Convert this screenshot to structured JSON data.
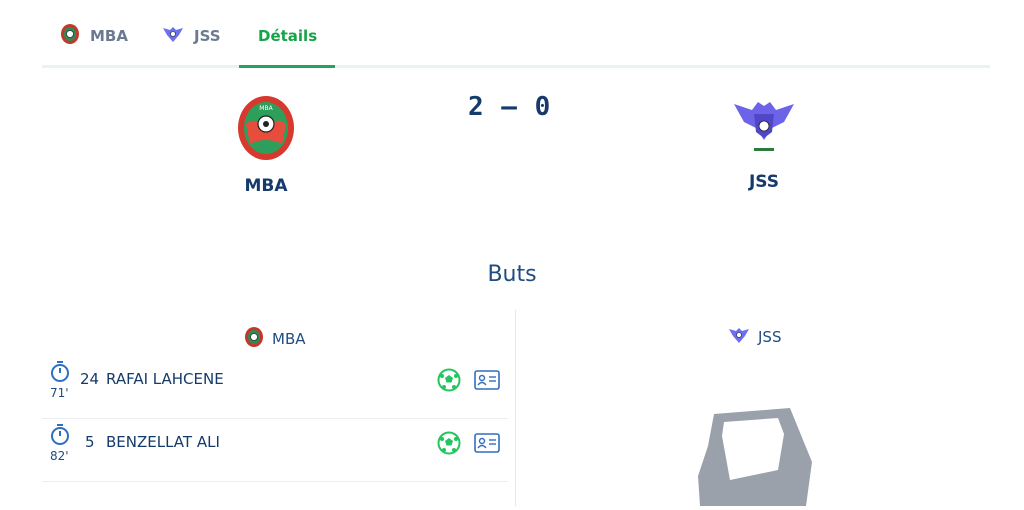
{
  "tabs": [
    {
      "label": "MBA",
      "icon": "mba-logo-icon"
    },
    {
      "label": "JSS",
      "icon": "jss-logo-icon"
    },
    {
      "label": "Détails",
      "active": true
    }
  ],
  "match": {
    "home": {
      "name": "MBA"
    },
    "away": {
      "name": "JSS"
    },
    "score": "2 — 0"
  },
  "goals_section": {
    "title": "Buts",
    "home": {
      "name": "MBA",
      "goals": [
        {
          "minute": "71'",
          "number": "24",
          "player": "RAFAI LAHCENE"
        },
        {
          "minute": "82'",
          "number": "5",
          "player": "BENZELLAT ALI"
        }
      ]
    },
    "away": {
      "name": "JSS",
      "goals": []
    }
  },
  "colors": {
    "accent": "#22a45d",
    "text": "#153a6b",
    "muted": "#6b7a90",
    "ball": "#22c55e"
  }
}
